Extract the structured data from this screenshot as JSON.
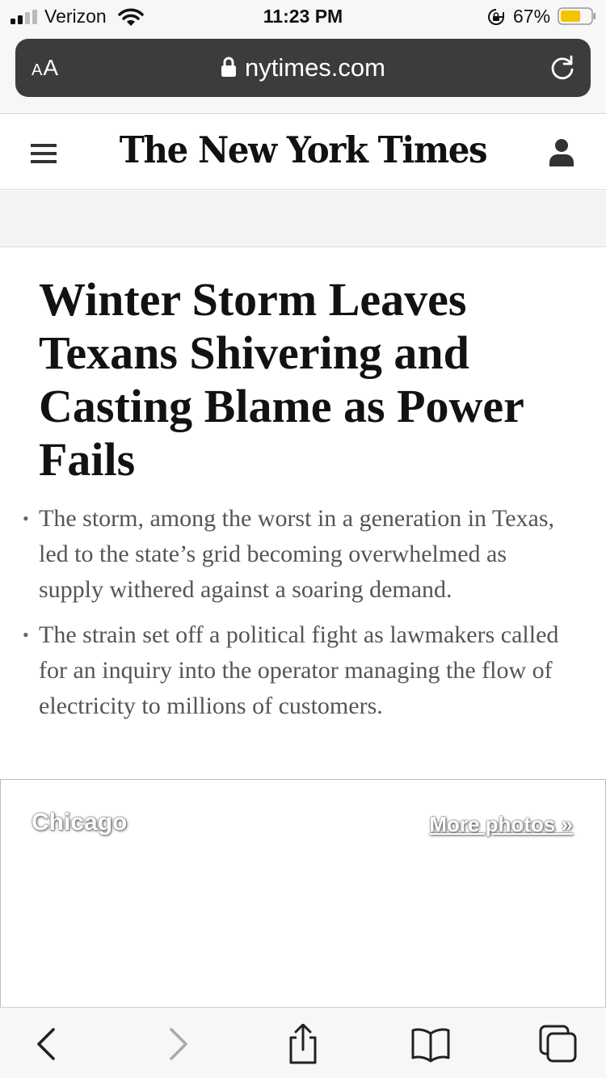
{
  "status_bar": {
    "carrier": "Verizon",
    "time": "11:23 PM",
    "battery_percent": "67%",
    "battery_color": "#f5c400"
  },
  "browser": {
    "text_size_label_small": "A",
    "text_size_label_large": "A",
    "url": "nytimes.com",
    "reload_icon": "reload-icon"
  },
  "site_header": {
    "masthead": "The New York Times",
    "menu_icon": "hamburger-menu-icon",
    "account_icon": "account-icon"
  },
  "article": {
    "headline": "Winter Storm Leaves Texans Shivering and Casting Blame as Power Fails",
    "summary": [
      "The storm, among the worst in a generation in Texas, led to the state’s grid becoming overwhelmed as supply withered against a soaring demand.",
      "The strain set off a political fight as lawmakers called for an inquiry into the operator managing the flow of electricity to millions of customers."
    ],
    "bullet": "•"
  },
  "photo_module": {
    "location": "Chicago",
    "more_link": "More photos »"
  },
  "toolbar": {
    "buttons": [
      "back-icon",
      "forward-icon",
      "share-icon",
      "bookmarks-icon",
      "tabs-icon"
    ]
  }
}
